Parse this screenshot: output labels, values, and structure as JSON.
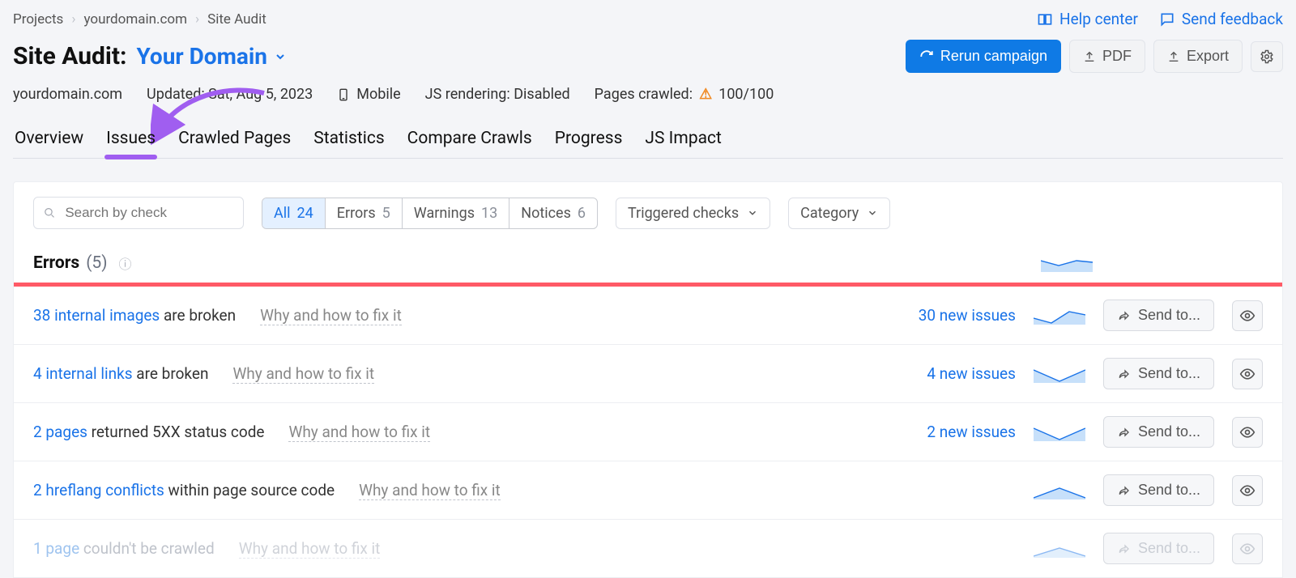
{
  "breadcrumb": [
    "Projects",
    "yourdomain.com",
    "Site Audit"
  ],
  "help": {
    "help_center": "Help center",
    "send_feedback": "Send feedback"
  },
  "title": {
    "label": "Site Audit:",
    "domain": "Your Domain"
  },
  "actions": {
    "rerun": "Rerun campaign",
    "pdf": "PDF",
    "export": "Export"
  },
  "meta": {
    "domain": "yourdomain.com",
    "updated": "Updated: Sat, Aug 5, 2023",
    "mobile": "Mobile",
    "js": "JS rendering: Disabled",
    "crawled_label": "Pages crawled:",
    "crawled_value": "100/100"
  },
  "tabs": [
    "Overview",
    "Issues",
    "Crawled Pages",
    "Statistics",
    "Compare Crawls",
    "Progress",
    "JS Impact"
  ],
  "filters": {
    "search_placeholder": "Search by check",
    "segments": [
      {
        "label": "All",
        "count": "24"
      },
      {
        "label": "Errors",
        "count": "5"
      },
      {
        "label": "Warnings",
        "count": "13"
      },
      {
        "label": "Notices",
        "count": "6"
      }
    ],
    "triggered": "Triggered checks",
    "category": "Category"
  },
  "section": {
    "label": "Errors",
    "count": "(5)"
  },
  "why_text": "Why and how to fix it",
  "send_to": "Send to...",
  "issues": [
    {
      "link": "38 internal images",
      "text": " are broken",
      "new": "30 new issues"
    },
    {
      "link": "4 internal links",
      "text": " are broken",
      "new": "4 new issues"
    },
    {
      "link": "2 pages",
      "text": " returned 5XX status code",
      "new": "2 new issues"
    },
    {
      "link": "2 hreflang conflicts",
      "text": " within page source code",
      "new": ""
    },
    {
      "link": "1 page",
      "text": " couldn't be crawled",
      "new": ""
    }
  ]
}
